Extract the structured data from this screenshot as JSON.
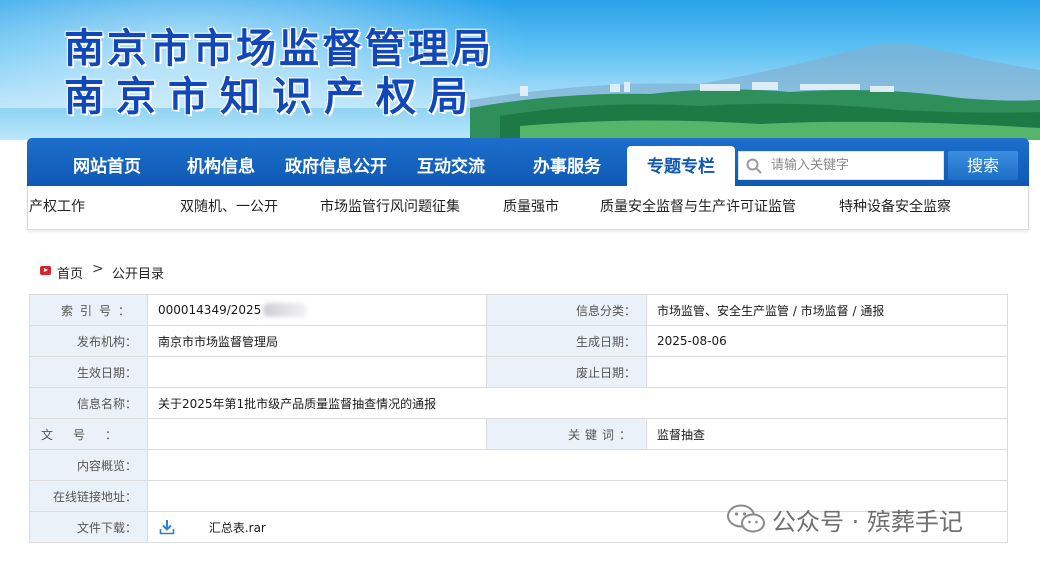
{
  "banner": {
    "title_line1": "南京市市场监督管理局",
    "title_line2": "南京市知识产权局"
  },
  "nav": {
    "items": [
      {
        "label": "网站首页"
      },
      {
        "label": "机构信息"
      },
      {
        "label": "政府信息公开"
      },
      {
        "label": "互动交流"
      },
      {
        "label": "办事服务"
      },
      {
        "label": "专题专栏",
        "active": true
      }
    ],
    "search_placeholder": "请输入关键字",
    "search_button": "搜索"
  },
  "subnav": {
    "items": [
      {
        "label": "识产权工作"
      },
      {
        "label": "双随机、一公开"
      },
      {
        "label": "市场监管行风问题征集"
      },
      {
        "label": "质量强市"
      },
      {
        "label": "质量安全监督与生产许可证监管"
      },
      {
        "label": "特种设备安全监察"
      }
    ]
  },
  "breadcrumb": {
    "home": "首页",
    "separator": ">",
    "current": "公开目录"
  },
  "info": {
    "index_no_label": "索引号：",
    "index_no_value": "000014349/2025",
    "category_label": "信息分类：",
    "category_value": "市场监管、安全生产监管 / 市场监督 / 通报",
    "publisher_label": "发布机构：",
    "publisher_value": "南京市市场监督管理局",
    "created_label": "生成日期：",
    "created_value": "2025-08-06",
    "effective_label": "生效日期：",
    "effective_value": "",
    "expiry_label": "废止日期：",
    "expiry_value": "",
    "title_label": "信息名称：",
    "title_value": "关于2025年第1批市级产品质量监督抽查情况的通报",
    "doc_no_label": "文号：",
    "doc_no_value": "",
    "keywords_label": "关键词：",
    "keywords_value": "监督抽查",
    "overview_label": "内容概览：",
    "overview_value": "",
    "link_label": "在线链接地址：",
    "link_value": "",
    "download_label": "文件下载：",
    "download_file": "汇总表.rar"
  },
  "watermark": {
    "text": "公众号 · 殡葬手记"
  },
  "colors": {
    "nav_blue": "#0f59b4",
    "title_blue": "#1147b8",
    "label_bg": "#ebf1f8",
    "accent_red": "#d6252b"
  }
}
